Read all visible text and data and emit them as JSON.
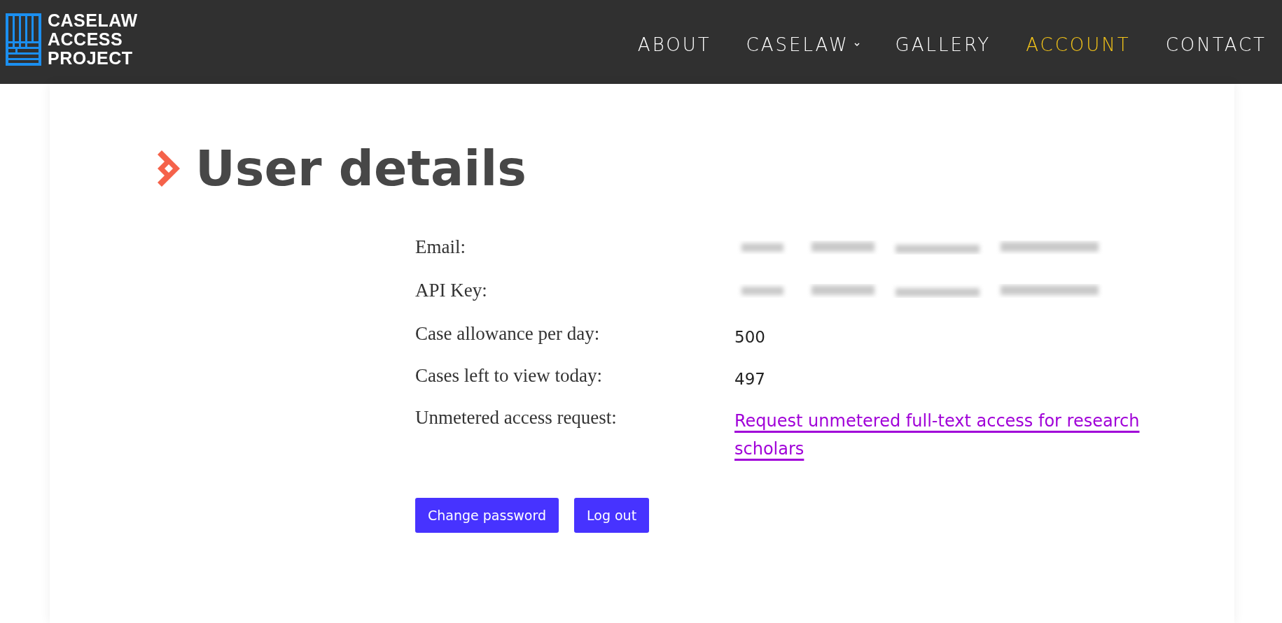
{
  "header": {
    "logo_lines": [
      "CASELAW",
      "ACCESS",
      "PROJECT"
    ],
    "nav": [
      {
        "label": "ABOUT",
        "selected": false,
        "dropdown": false
      },
      {
        "label": "CASELAW",
        "selected": false,
        "dropdown": true
      },
      {
        "label": "GALLERY",
        "selected": false,
        "dropdown": false
      },
      {
        "label": "ACCOUNT",
        "selected": true,
        "dropdown": false
      },
      {
        "label": "CONTACT",
        "selected": false,
        "dropdown": false
      }
    ]
  },
  "title": "User details",
  "details": [
    {
      "label": "Email:",
      "kind": "redacted"
    },
    {
      "label": "API Key:",
      "kind": "redacted"
    },
    {
      "label": "Case allowance per day:",
      "kind": "text",
      "value": "500"
    },
    {
      "label": "Cases left to view today:",
      "kind": "text",
      "value": "497"
    },
    {
      "label": "Unmetered access request:",
      "kind": "link",
      "value": "Request unmetered full-text access for research scholars"
    }
  ],
  "buttons": [
    "Change password",
    "Log out"
  ]
}
